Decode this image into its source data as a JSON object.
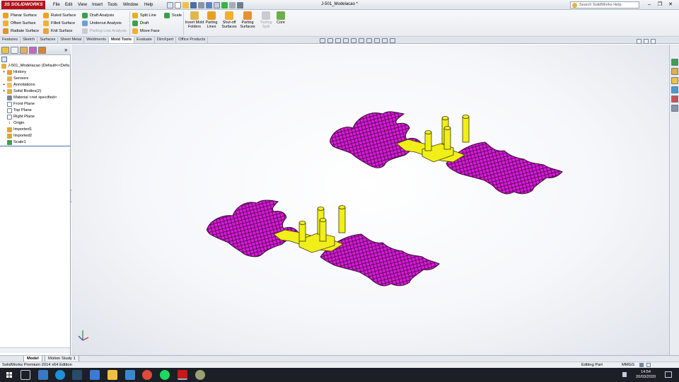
{
  "app": {
    "logo_text": "SOLIDWORKS",
    "doc_title": "J-501_Modelacao *",
    "accent": "#b3121b"
  },
  "menu": [
    "File",
    "Edit",
    "View",
    "Insert",
    "Tools",
    "Window",
    "Help"
  ],
  "search": {
    "placeholder": "Search SolidWorks Help"
  },
  "window_controls": {
    "minimize": "–",
    "restore": "❐",
    "close": "✕"
  },
  "ribbon": {
    "col1": [
      "Planar Surface",
      "Offset Surface",
      "Radiate Surface"
    ],
    "col2": [
      "Ruled Surface",
      "Filled Surface",
      "Knit Surface"
    ],
    "col3": [
      "Draft Analysis",
      "Undercut Analysis",
      "Parting Line Analysis"
    ],
    "col4": [
      "Split Line",
      "Draft",
      "Move Face"
    ],
    "col5": [
      "Scale"
    ],
    "big": [
      {
        "label": "Insert Mold Folders",
        "icon": "insert-mold-folders-icon"
      },
      {
        "label": "Parting Lines",
        "icon": "parting-lines-icon"
      },
      {
        "label": "Shut-off Surfaces",
        "icon": "shut-off-surfaces-icon"
      },
      {
        "label": "Parting Surfaces",
        "icon": "parting-surfaces-icon"
      },
      {
        "label": "Tooling Split",
        "icon": "tooling-split-icon"
      },
      {
        "label": "Core",
        "icon": "core-icon"
      }
    ]
  },
  "tabs": [
    "Features",
    "Sketch",
    "Surfaces",
    "Sheet Metal",
    "Weldments",
    "Mold Tools",
    "Evaluate",
    "DimXpert",
    "Office Products"
  ],
  "active_tab": "Mold Tools",
  "tree": {
    "root": "J-501_Modelacao  (Default<<Defa",
    "items": [
      "History",
      "Sensors",
      "Annotations",
      "Solid Bodies(2)",
      "Material <not specified>",
      "Front Plane",
      "Top Plane",
      "Right Plane",
      "Origin",
      "Imported1",
      "Imported2",
      "Scale1"
    ]
  },
  "bottom_tabs": [
    "Model",
    "Motion Study 1"
  ],
  "status": {
    "edition": "SolidWorks Premium 2014 x64 Edition",
    "mode": "Editing Part",
    "units": "MMGS"
  },
  "taskbar": {
    "time": "14:54",
    "date": "20/03/2020"
  },
  "colors": {
    "part_magenta": "#d81ad8",
    "part_yellow": "#f2ee1a",
    "outline": "#3a0a3a"
  }
}
